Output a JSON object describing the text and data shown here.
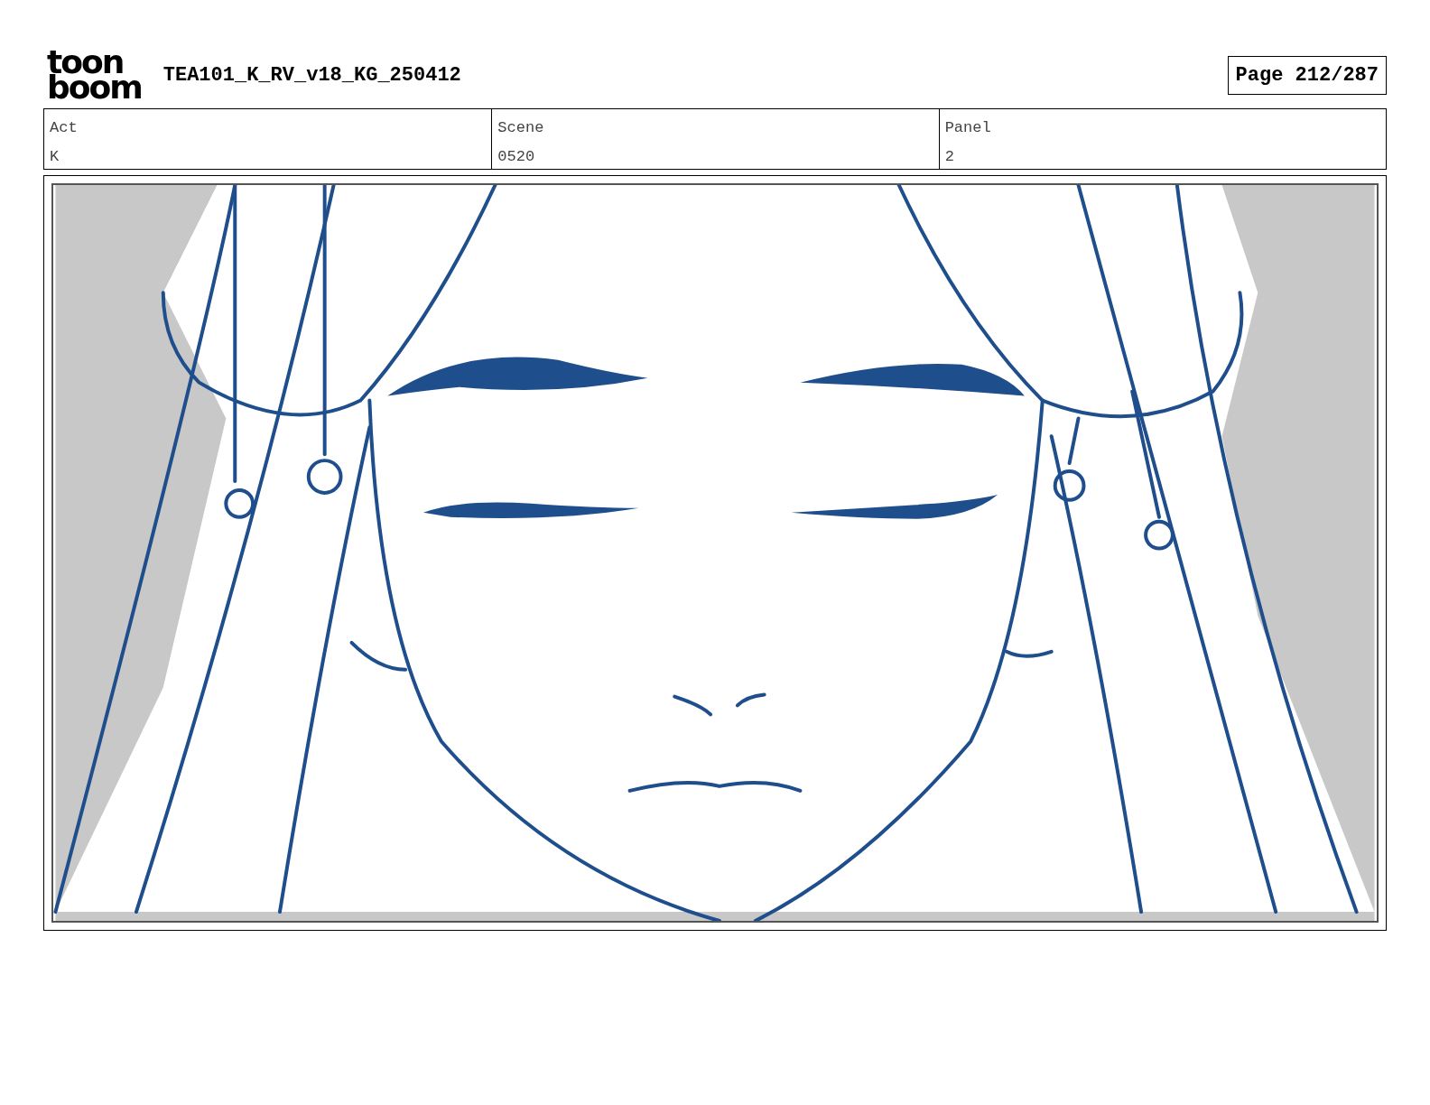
{
  "logo": {
    "lines": [
      "toon",
      "boom"
    ]
  },
  "title": "TEA101_K_RV_v18_KG_250412",
  "page": "Page 212/287",
  "fields": [
    {
      "label": "Act",
      "value": "K"
    },
    {
      "label": "Scene",
      "value": "0520"
    },
    {
      "label": "Panel",
      "value": "2"
    }
  ]
}
